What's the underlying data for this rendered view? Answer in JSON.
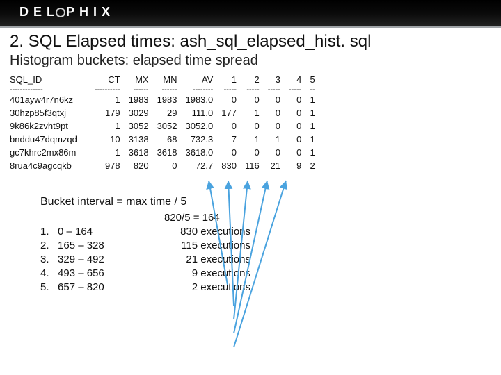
{
  "logo_text": "DELPHIX",
  "title": "2. SQL Elapsed times: ash_sql_elapsed_hist. sql",
  "subtitle": "Histogram buckets: elapsed time spread",
  "columns": [
    "SQL_ID",
    "CT",
    "MX",
    "MN",
    "AV",
    "1",
    "2",
    "3",
    "4",
    "5"
  ],
  "dividers": [
    "-------------",
    "----------",
    "------",
    "------",
    "--------",
    "-----",
    "-----",
    "-----",
    "-----",
    "--"
  ],
  "rows": [
    {
      "id": "401ayw4r7n6kz",
      "ct": "1",
      "mx": "1983",
      "mn": "1983",
      "av": "1983.0",
      "b1": "0",
      "b2": "0",
      "b3": "0",
      "b4": "0",
      "b5": "1"
    },
    {
      "id": "30hzp85f3qtxj",
      "ct": "179",
      "mx": "3029",
      "mn": "29",
      "av": "111.0",
      "b1": "177",
      "b2": "1",
      "b3": "0",
      "b4": "0",
      "b5": "1"
    },
    {
      "id": "9k86k2zvht9pt",
      "ct": "1",
      "mx": "3052",
      "mn": "3052",
      "av": "3052.0",
      "b1": "0",
      "b2": "0",
      "b3": "0",
      "b4": "0",
      "b5": "1"
    },
    {
      "id": "bnddu47dqmzqd",
      "ct": "10",
      "mx": "3138",
      "mn": "68",
      "av": "732.3",
      "b1": "7",
      "b2": "1",
      "b3": "1",
      "b4": "0",
      "b5": "1"
    },
    {
      "id": "gc7khrc2mx86m",
      "ct": "1",
      "mx": "3618",
      "mn": "3618",
      "av": "3618.0",
      "b1": "0",
      "b2": "0",
      "b3": "0",
      "b4": "0",
      "b5": "1"
    },
    {
      "id": "8rua4c9agcqkb",
      "ct": "978",
      "mx": "820",
      "mn": "0",
      "av": "72.7",
      "b1": "830",
      "b2": "116",
      "b3": "21",
      "b4": "9",
      "b5": "2"
    }
  ],
  "note": "Bucket interval = max time / 5",
  "ranges_header": "820/5 = 164",
  "ranges": [
    {
      "n": "1.",
      "r": "0 – 164",
      "e": "830 executions"
    },
    {
      "n": "2.",
      "r": "165 – 328",
      "e": "115 executions"
    },
    {
      "n": "3.",
      "r": "329 – 492",
      "e": "21 executions"
    },
    {
      "n": "4.",
      "r": "493 – 656",
      "e": "9 executions"
    },
    {
      "n": "5.",
      "r": "657 – 820",
      "e": "2 executions"
    }
  ]
}
